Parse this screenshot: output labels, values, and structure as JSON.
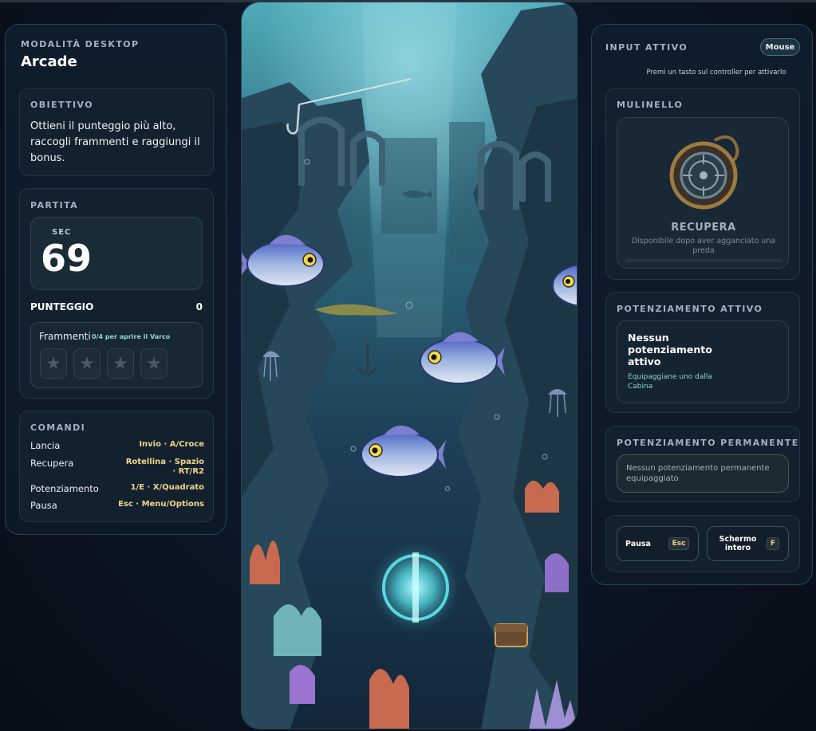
{
  "left_panel": {
    "mode_label": "MODALITÀ DESKTOP",
    "mode_value": "Arcade",
    "objective": {
      "label": "OBIETTIVO",
      "text": "Ottieni il punteggio più alto, raccogli frammenti e raggiungi il bonus."
    },
    "match": {
      "label": "PARTITA",
      "timer_unit": "SEC",
      "timer_value": "69",
      "score_label": "PUNTEGGIO",
      "score_value": "0",
      "fragments_label": "Frammenti",
      "fragments_hint": "0/4 per aprire il Varco",
      "fragments_collected": 0,
      "fragments_total": 4,
      "star_icon": "star-icon"
    },
    "commands": {
      "label": "COMANDI",
      "rows": [
        {
          "name": "Lancia",
          "keys": "Invio · A/Croce"
        },
        {
          "name": "Recupera",
          "keys": "Rotellina · Spazio · RT/R2"
        },
        {
          "name": "Potenziamento",
          "keys": "1/E · X/Quadrato"
        },
        {
          "name": "Pausa",
          "keys": "Esc · Menu/Options"
        }
      ]
    }
  },
  "right_panel": {
    "input_label": "INPUT ATTIVO",
    "input_device": "Mouse",
    "input_hint": "Premi un tasto sul controller per attivarlo",
    "reel": {
      "label": "MULINELLO",
      "icon": "fishing-reel-icon",
      "action": "RECUPERA",
      "subtitle": "Disponibile dopo aver agganciato una preda",
      "progress": 0
    },
    "active_powerup": {
      "label": "POTENZIAMENTO ATTIVO",
      "title": "Nessun potenziamento attivo",
      "subtitle": "Equipaggiane uno dalla Cabina"
    },
    "permanent_powerup": {
      "label": "POTENZIAMENTO PERMANENTE",
      "text": "Nessun potenziamento permanente equipaggiato"
    },
    "actions": {
      "pause_label": "Pausa",
      "pause_key": "Esc",
      "fullscreen_label": "Schermo intero",
      "fullscreen_key": "F"
    }
  },
  "colors": {
    "accent_teal": "#8fd6c8",
    "key_gold": "#f2d489",
    "panel_bg": "#0f1c2b"
  }
}
